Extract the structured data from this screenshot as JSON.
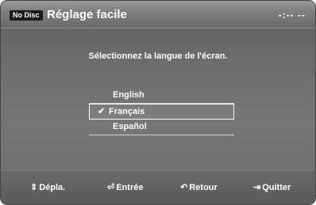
{
  "header": {
    "badge": "No Disc",
    "title": "Réglage facile",
    "time": "-:-- --"
  },
  "main": {
    "prompt": "Sélectionnez la langue de l'écran.",
    "options": [
      {
        "label": "English",
        "selected": false
      },
      {
        "label": "Français",
        "selected": true
      },
      {
        "label": "Español",
        "selected": false
      }
    ],
    "selected_mark": "✔"
  },
  "footer": {
    "move": {
      "label": "Dépla.",
      "icon": "up-down-arrows-icon"
    },
    "enter": {
      "label": "Entrée",
      "icon": "enter-icon"
    },
    "back": {
      "label": "Retour",
      "icon": "return-icon"
    },
    "exit": {
      "label": "Quitter",
      "icon": "exit-icon"
    }
  },
  "colors": {
    "background": "#6f6f6f",
    "text": "#ffffff",
    "badge": "#1c1c1c"
  }
}
